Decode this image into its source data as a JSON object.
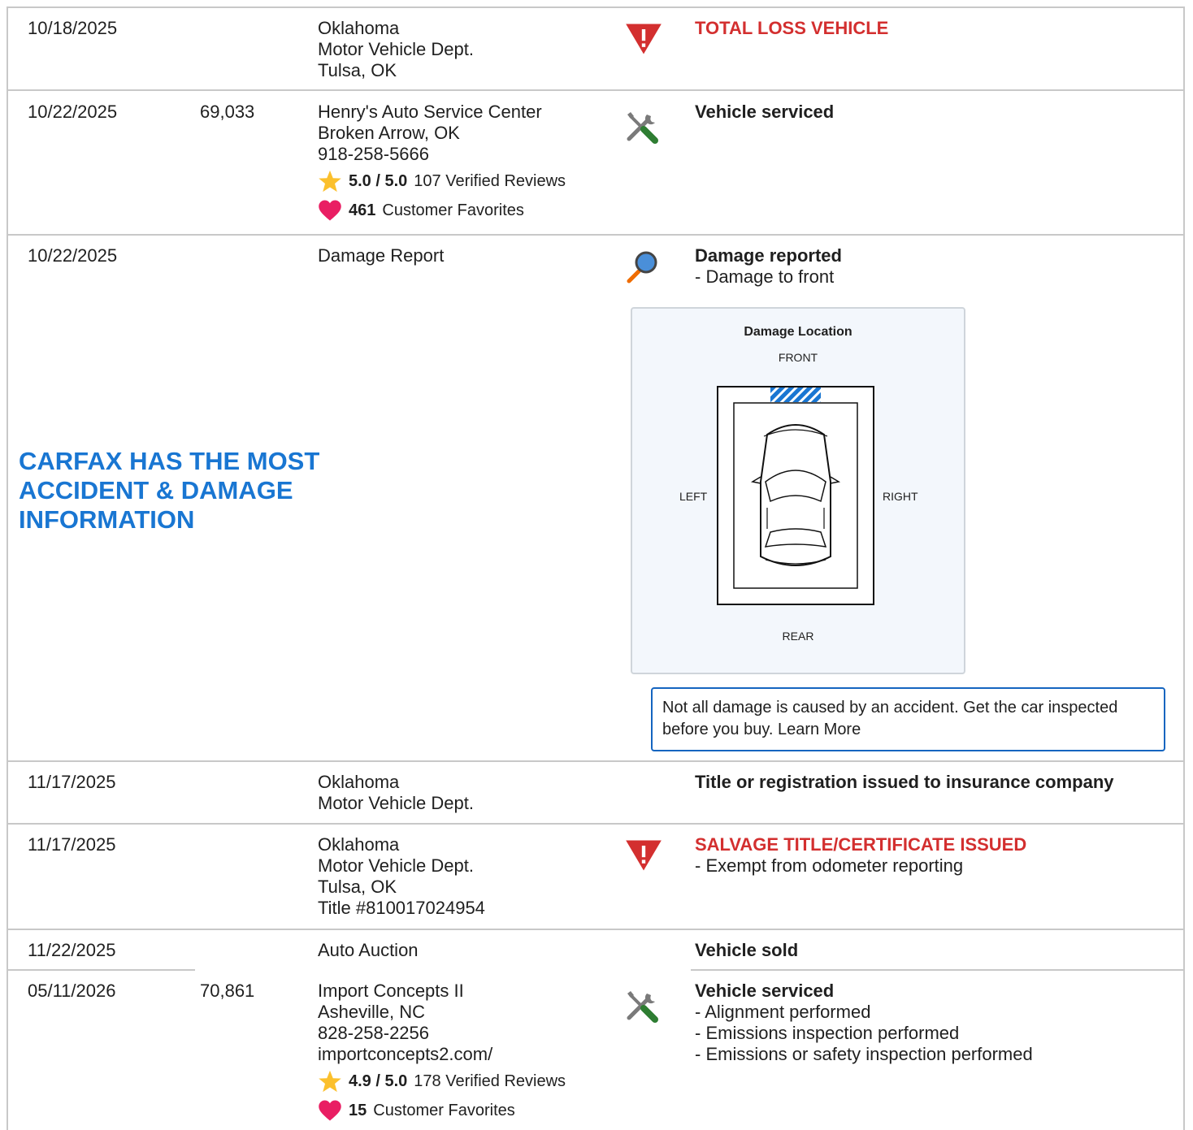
{
  "records": [
    {
      "date": "10/18/2025",
      "odometer": "",
      "source": [
        "Oklahoma",
        "Motor Vehicle Dept.",
        "Tulsa, OK"
      ],
      "icon": "warning-icon",
      "comment_title": "TOTAL LOSS VEHICLE",
      "comment_lines": []
    },
    {
      "date": "10/22/2025",
      "odometer": "69,033",
      "source": [
        "Henry's Auto Service Center",
        "Broken Arrow, OK",
        "918-258-5666"
      ],
      "rating": "5.0 / 5.0",
      "reviews": "107 Verified Reviews",
      "favorites_count": "461",
      "favorites_label": "Customer Favorites",
      "icon": "service-tools-icon",
      "comment_title": "Vehicle serviced",
      "comment_lines": []
    },
    {
      "date": "10/22/2025",
      "odometer": "",
      "source": [
        "Damage Report"
      ],
      "icon": "magnifier-icon",
      "comment_title": "Damage reported",
      "comment_lines": [
        "- Damage to front"
      ]
    },
    {
      "date": "11/17/2025",
      "odometer": "",
      "source": [
        "Oklahoma",
        "Motor Vehicle Dept."
      ],
      "icon": "",
      "comment_title": "Title or registration issued to insurance company",
      "comment_lines": []
    },
    {
      "date": "11/17/2025",
      "odometer": "",
      "source": [
        "Oklahoma",
        "Motor Vehicle Dept.",
        "Tulsa, OK",
        "Title #810017024954"
      ],
      "icon": "warning-icon",
      "comment_title": "SALVAGE TITLE/CERTIFICATE ISSUED",
      "comment_lines": [
        "- Exempt from odometer reporting"
      ]
    },
    {
      "date": "11/22/2025",
      "odometer": "",
      "source": [
        "Auto Auction"
      ],
      "icon": "",
      "comment_title": "Vehicle sold",
      "comment_lines": []
    },
    {
      "date": "05/11/2026",
      "odometer": "70,861",
      "source": [
        "Import Concepts II",
        "Asheville, NC",
        "828-258-2256",
        "importconcepts2.com/"
      ],
      "rating": "4.9 / 5.0",
      "reviews": "178 Verified Reviews",
      "favorites_count": "15",
      "favorites_label": "Customer Favorites",
      "icon": "service-tools-icon",
      "comment_title": "Vehicle serviced",
      "comment_lines": [
        "- Alignment performed",
        "- Emissions inspection performed",
        "- Emissions or safety inspection performed"
      ]
    }
  ],
  "promo": [
    "CARFAX HAS THE MOST",
    "ACCIDENT & DAMAGE",
    "INFORMATION"
  ],
  "damage_diagram": {
    "title": "Damage Location",
    "front": "FRONT",
    "rear": "REAR",
    "left": "LEFT",
    "right": "RIGHT",
    "damaged_area": "front"
  },
  "damage_note": "Not all damage is caused by an accident. Get the car inspected before you buy. Learn More",
  "colors": {
    "alert": "#d32f2f",
    "promo": "#1976d2",
    "star": "#fbc02d",
    "heart": "#e91e63",
    "damage_hatch": "#1976d2"
  }
}
